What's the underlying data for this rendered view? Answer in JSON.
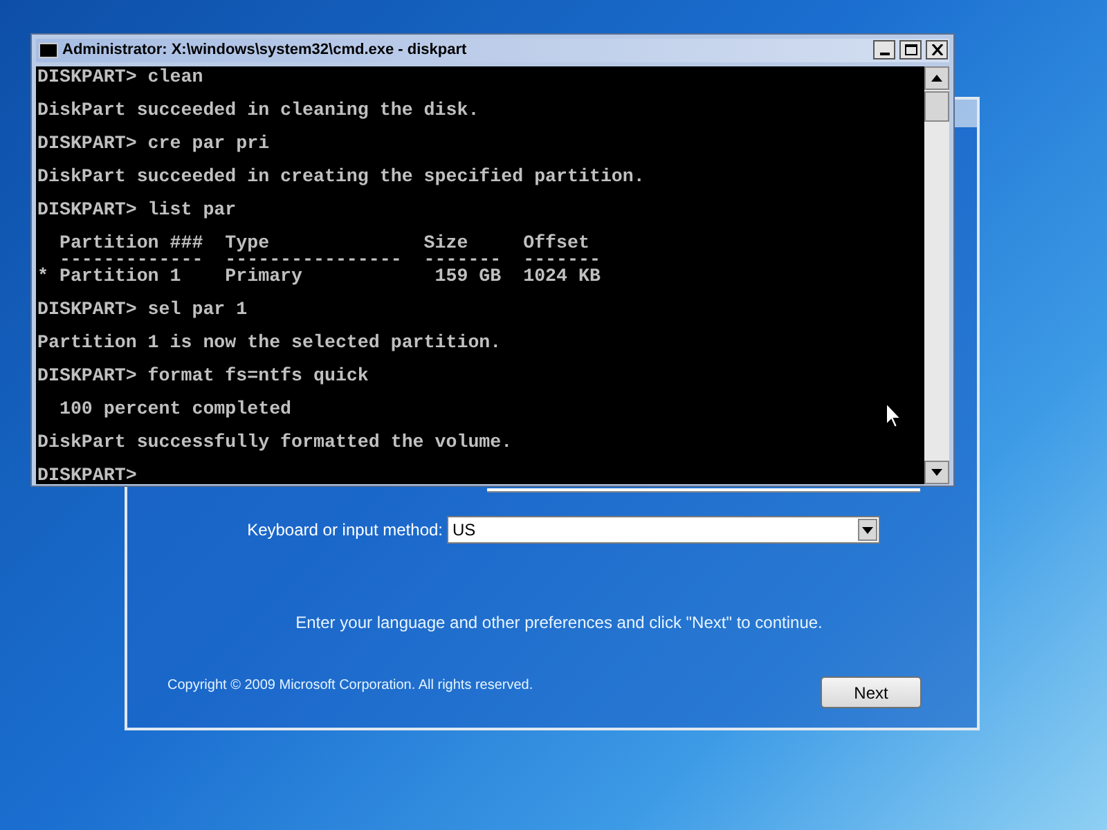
{
  "console_window": {
    "title": "Administrator: X:\\windows\\system32\\cmd.exe - diskpart",
    "paragraphs": [
      [
        "DISKPART> clean"
      ],
      [
        "DiskPart succeeded in cleaning the disk."
      ],
      [
        "DISKPART> cre par pri"
      ],
      [
        "DiskPart succeeded in creating the specified partition."
      ],
      [
        "DISKPART> list par"
      ],
      [
        "  Partition ###  Type              Size     Offset",
        "  -------------  ----------------  -------  -------",
        "* Partition 1    Primary            159 GB  1024 KB"
      ],
      [
        "DISKPART> sel par 1"
      ],
      [
        "Partition 1 is now the selected partition."
      ],
      [
        "DISKPART> format fs=ntfs quick"
      ],
      [
        "  100 percent completed"
      ],
      [
        "DiskPart successfully formatted the volume."
      ],
      [
        "DISKPART> "
      ]
    ]
  },
  "setup_window": {
    "keyboard_label": "Keyboard or input method:",
    "keyboard_value": "US",
    "instruction": "Enter your language and other preferences and click \"Next\" to continue.",
    "copyright": "Copyright © 2009 Microsoft Corporation. All rights reserved.",
    "next_button": "Next"
  }
}
